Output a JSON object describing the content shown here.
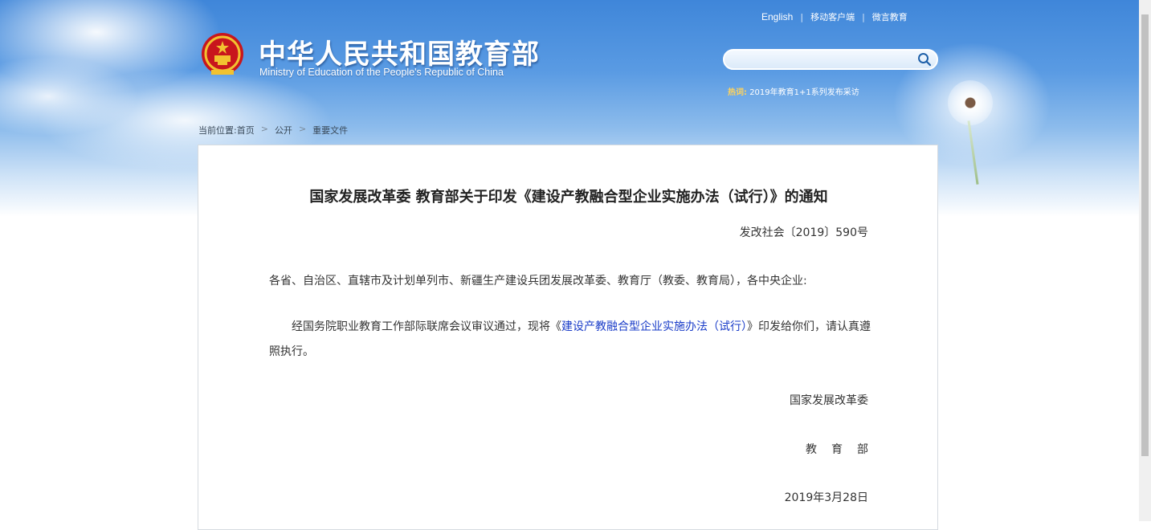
{
  "header": {
    "links": [
      "English",
      "移动客户端",
      "微言教育"
    ],
    "site_title": "中华人民共和国教育部",
    "site_subtitle": "Ministry of Education of the People's Republic of China",
    "search": {
      "value": "",
      "placeholder": ""
    },
    "hot": {
      "label": "热词:",
      "item": "2019年教育1+1系列发布采访"
    }
  },
  "breadcrumb": {
    "label": "当前位置:",
    "items": [
      "首页",
      "公开",
      "重要文件"
    ]
  },
  "document": {
    "title": "国家发展改革委 教育部关于印发《建设产教融合型企业实施办法（试行）》的通知",
    "number": "发改社会〔2019〕590号",
    "addressee": "各省、自治区、直辖市及计划单列市、新疆生产建设兵团发展改革委、教育厅（教委、教育局），各中央企业:",
    "body_before": "经国务院职业教育工作部际联席会议审议通过，现将《",
    "body_link": "建设产教融合型企业实施办法（试行）",
    "body_after": "》印发给你们，请认真遵照执行。",
    "signature_1": "国家发展改革委",
    "signature_2": "教育部",
    "date": "2019年3月28日"
  },
  "colors": {
    "sky_top": "#3f86d9",
    "link": "#1a3cc8",
    "hot_label": "#ffd35c"
  }
}
